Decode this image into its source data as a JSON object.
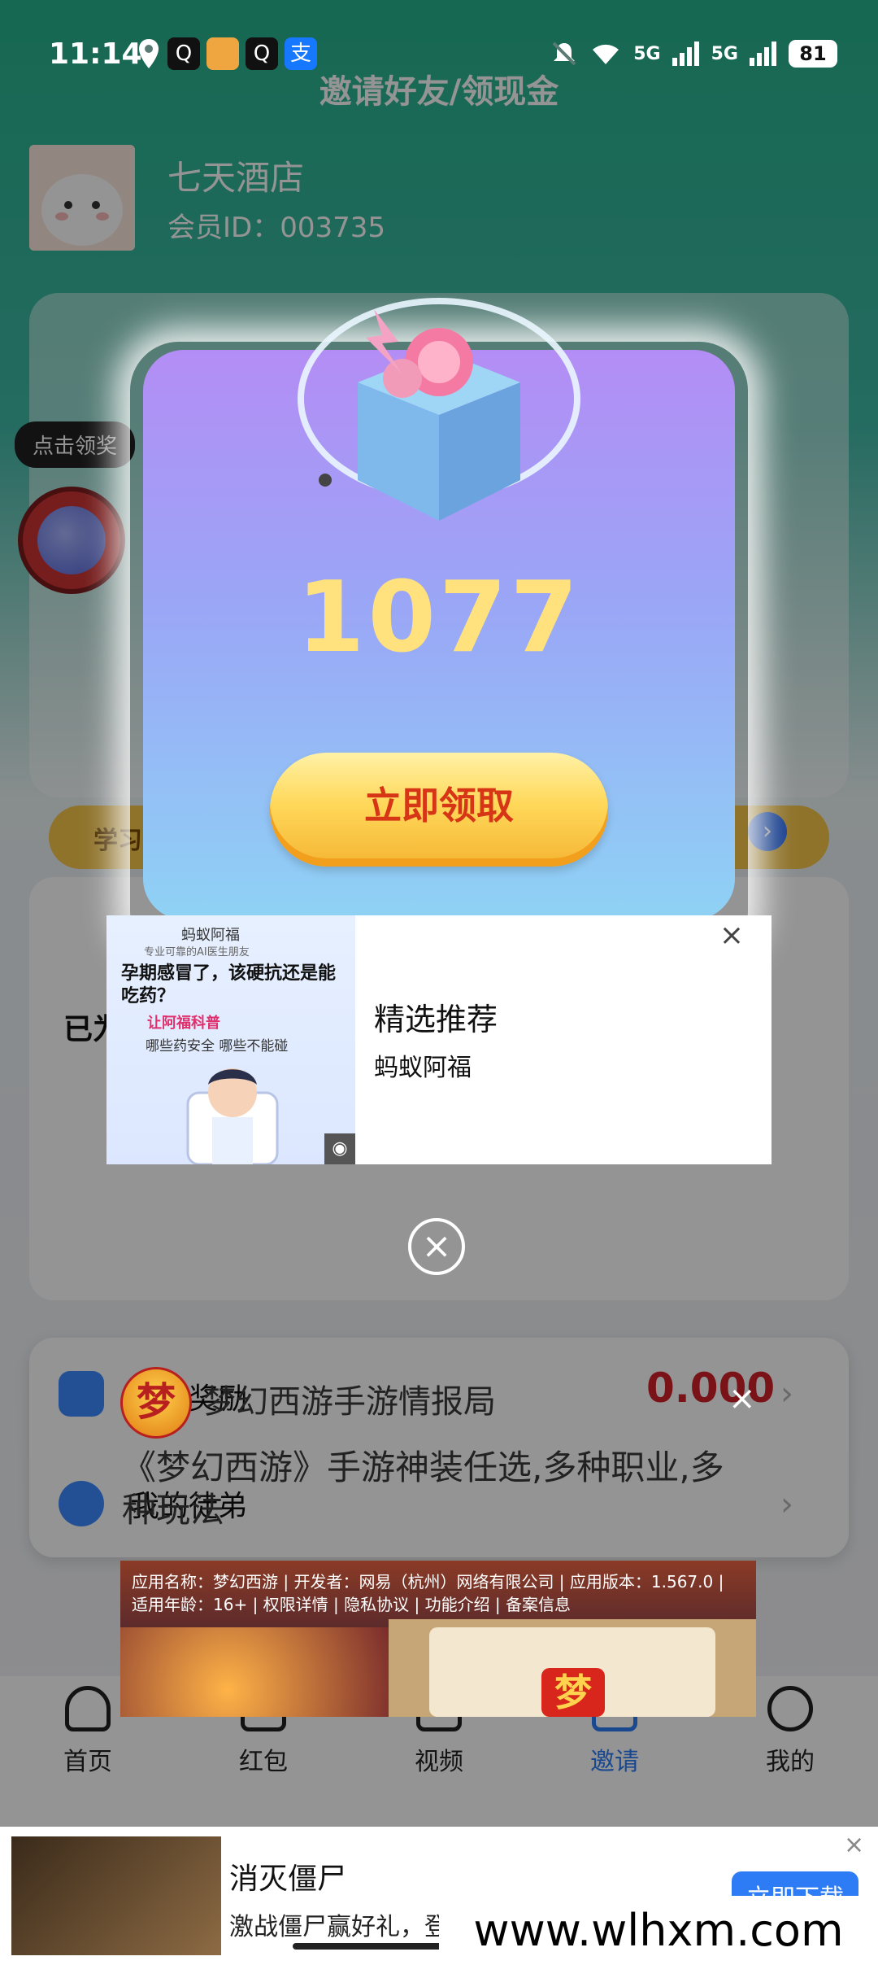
{
  "status_bar": {
    "time": "11:14",
    "network_5g_1": "5G",
    "network_5g_2": "5G",
    "battery": "81",
    "qq": "Q",
    "alipay": "支"
  },
  "page": {
    "title": "邀请好友/领现金",
    "user_name": "七天酒店",
    "user_id": "会员ID：003735",
    "claim_bubble": "点击领奖",
    "learn_label": "学习",
    "learn_arrow": "›",
    "yi_label": "已为",
    "list_rows": [
      {
        "label": "我的奖励",
        "amount": "0.000"
      },
      {
        "label": "我的徒弟"
      }
    ]
  },
  "reward_modal": {
    "amount": "1077",
    "claim_button": "立即领取",
    "close": "×"
  },
  "ad": {
    "image_brand": "蚂蚁阿福",
    "image_sub": "专业可靠的AI医生朋友",
    "image_headline": "孕期感冒了，该硬抗还是能吃药？",
    "image_pink": "让阿福科普",
    "image_line": "哪些药安全 哪些不能碰",
    "image_logo": "◉",
    "title": "精选推荐",
    "brand": "蚂蚁阿福",
    "close": "×"
  },
  "game_ad": {
    "avatar_char": "梦",
    "source": "梦幻西游手游情报局",
    "desc": "《梦幻西游》手游神装任选,多种职业,多种玩法",
    "info": "应用名称：梦幻西游 | 开发者：网易（杭州）网络有限公司 | 应用版本：1.567.0 | 适用年龄：16+ | 权限详情 | 隐私协议 | 功能介绍 | 备案信息",
    "close": "×",
    "logo_char": "梦"
  },
  "bottom_nav": [
    {
      "label": "首页"
    },
    {
      "label": "红包"
    },
    {
      "label": "视频"
    },
    {
      "label": "邀请",
      "active": true
    },
    {
      "label": "我的"
    }
  ],
  "banner": {
    "title": "消灭僵尸",
    "desc": "激战僵尸赢好礼，登",
    "button": "立即下载",
    "close": "×"
  },
  "watermark": "www.wlhxm.com",
  "colors": {
    "amount": "#ffe27d",
    "claim_text": "#d63616",
    "reward_amount": "#d0222a",
    "nav_active": "#2d7cf6"
  }
}
